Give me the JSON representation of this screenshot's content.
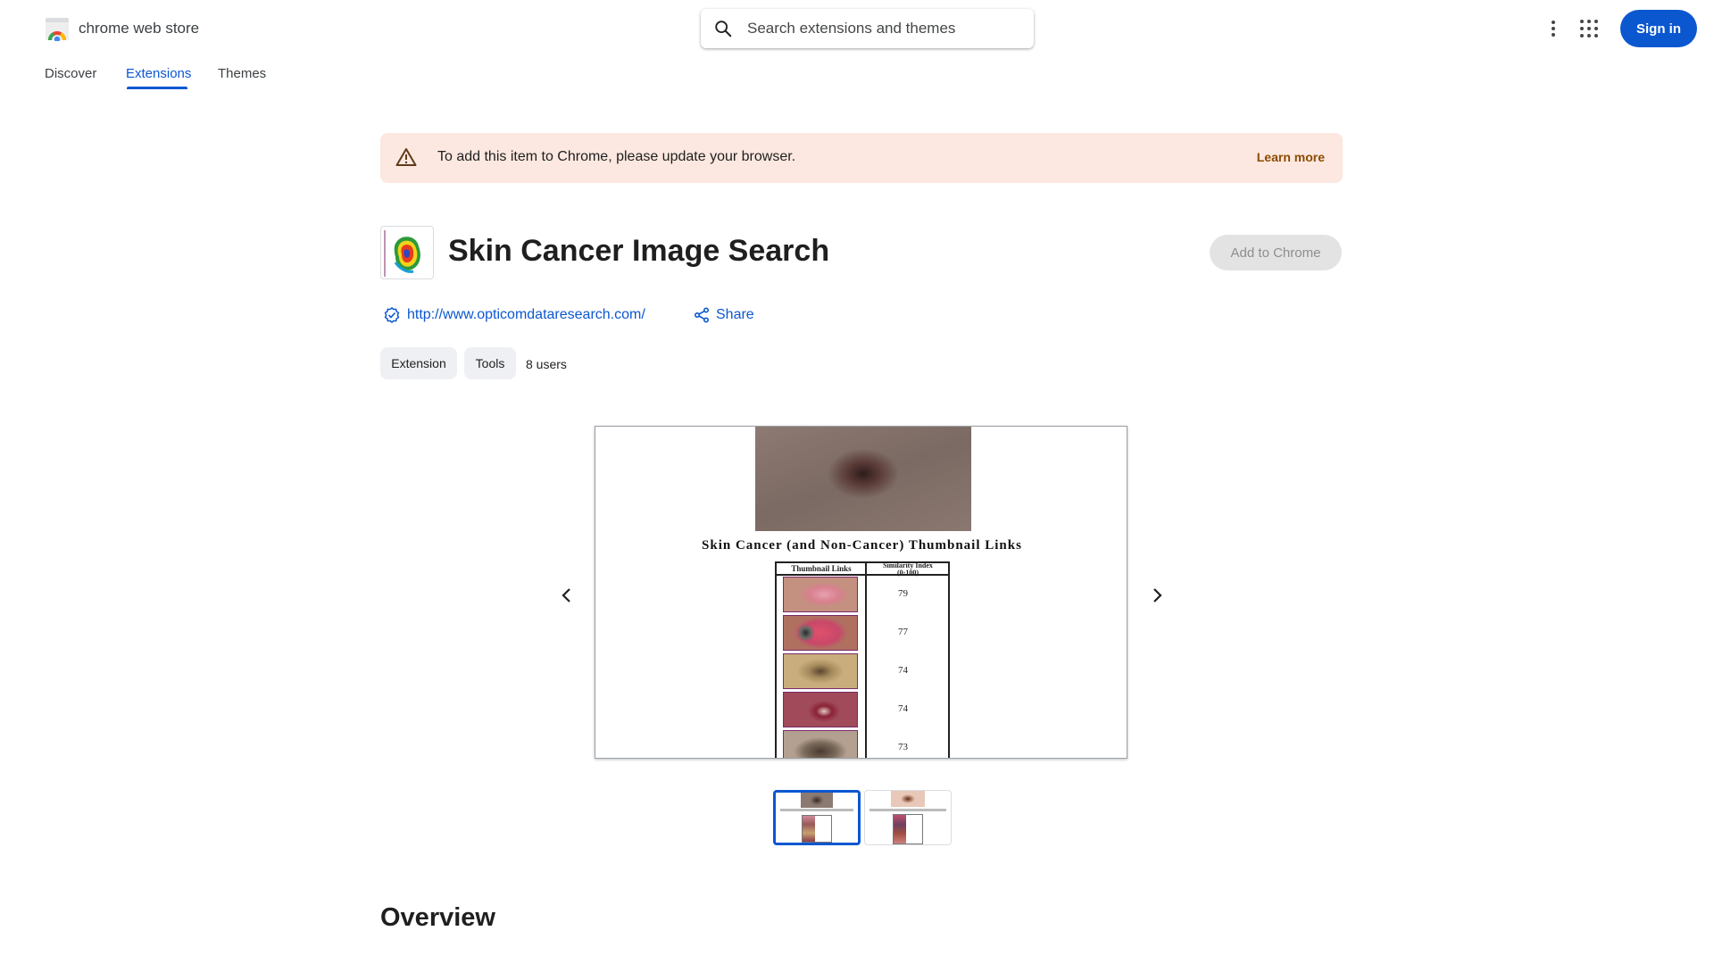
{
  "header": {
    "store_name": "chrome web store",
    "search_placeholder": "Search extensions and themes",
    "sign_in_label": "Sign in"
  },
  "nav": {
    "tabs": [
      {
        "label": "Discover"
      },
      {
        "label": "Extensions",
        "active": true
      },
      {
        "label": "Themes"
      }
    ]
  },
  "banner": {
    "message": "To add this item to Chrome, please update your browser.",
    "link_label": "Learn more"
  },
  "extension": {
    "title": "Skin Cancer Image Search",
    "add_button_label": "Add to Chrome",
    "website": "http://www.opticomdataresearch.com/",
    "share_label": "Share",
    "chips": [
      "Extension",
      "Tools"
    ],
    "users": "8 users"
  },
  "screenshot": {
    "heading": "Skin Cancer (and Non-Cancer) Thumbnail Links",
    "col1_header": "Thumbnail Links",
    "col2_header": "Similarity Index",
    "col2_subheader": "(0-100)",
    "scores": [
      "79",
      "77",
      "74",
      "74",
      "73"
    ],
    "thumbnail_count": 2,
    "selected_thumbnail": 1
  },
  "overview": {
    "title": "Overview"
  },
  "colors": {
    "accent": "#0b57d0",
    "banner_bg": "#fce8e0",
    "learn_more": "#8c4a00"
  },
  "icons": [
    "chrome-web-store-logo",
    "search-icon",
    "more-vert-icon",
    "apps-grid-icon",
    "warning-icon",
    "verified-icon",
    "share-icon",
    "chevron-left-icon",
    "chevron-right-icon"
  ]
}
